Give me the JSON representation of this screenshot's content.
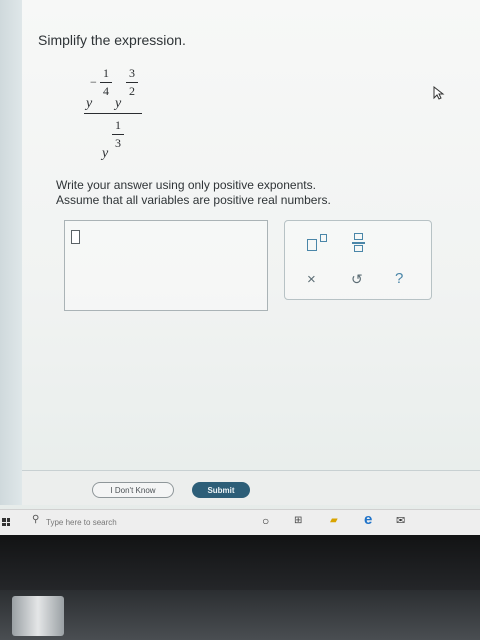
{
  "question": {
    "prompt": "Simplify the expression.",
    "expression": {
      "numerator": {
        "term1": {
          "base": "y",
          "exp_sign": "−",
          "exp_num": "1",
          "exp_den": "4"
        },
        "term2": {
          "base": "y",
          "exp_num": "3",
          "exp_den": "2"
        }
      },
      "denominator": {
        "base": "y",
        "exp_num": "1",
        "exp_den": "3"
      }
    },
    "instruction_line1": "Write your answer using only positive exponents.",
    "instruction_line2": "Assume that all variables are positive real numbers."
  },
  "toolbar": {
    "superscript": "superscript-template",
    "fraction": "fraction-template",
    "clear": "×",
    "undo": "↺",
    "help": "?"
  },
  "actions": {
    "dont_know_label": "I Don't Know",
    "submit_label": "Submit"
  },
  "taskbar": {
    "search_placeholder": "Type here to search"
  },
  "colors": {
    "accent": "#4a86a8",
    "submit_bg": "#2d5e78"
  }
}
